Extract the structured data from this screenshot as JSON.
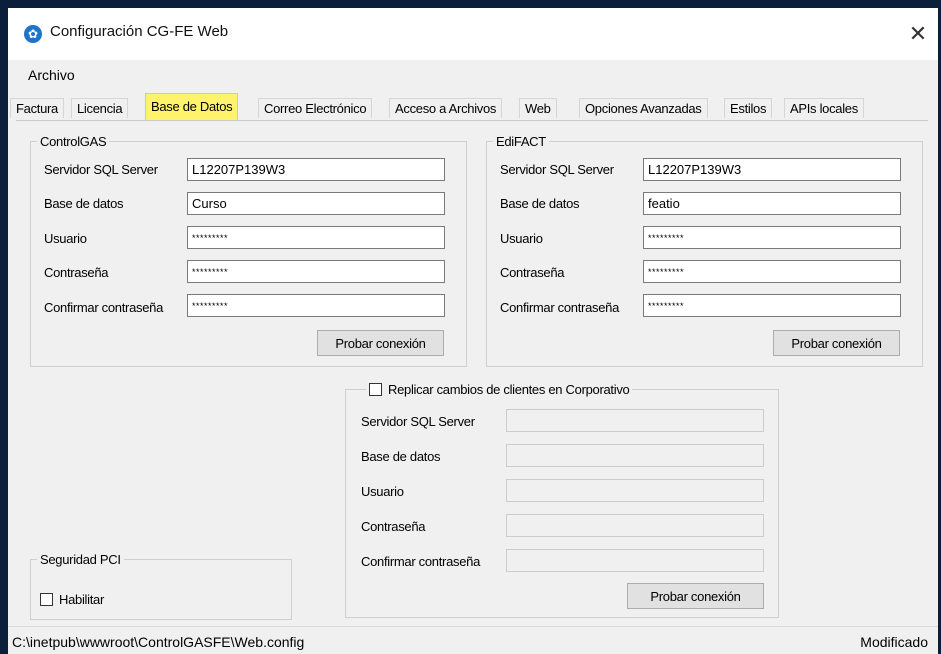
{
  "window": {
    "title": "Configuración CG-FE Web",
    "close_glyph": "✕"
  },
  "menu": {
    "archivo": "Archivo"
  },
  "tabs": [
    {
      "label": "Factura"
    },
    {
      "label": "Licencia"
    },
    {
      "label": "Base de Datos",
      "active": true
    },
    {
      "label": "Correo Electrónico"
    },
    {
      "label": "Acceso a Archivos"
    },
    {
      "label": "Web"
    },
    {
      "label": "Opciones Avanzadas"
    },
    {
      "label": "Estilos"
    },
    {
      "label": "APIs locales"
    }
  ],
  "controlgas": {
    "title": "ControlGAS",
    "server_label": "Servidor SQL Server",
    "server_value": "L12207P139W3",
    "db_label": "Base de datos",
    "db_value": "Curso",
    "user_label": "Usuario",
    "user_value": "*********",
    "pass_label": "Contraseña",
    "pass_value": "*********",
    "confirm_label": "Confirmar contraseña",
    "confirm_value": "*********",
    "test_button": "Probar conexión"
  },
  "edifact": {
    "title": "EdiFACT",
    "server_label": "Servidor SQL Server",
    "server_value": "L12207P139W3",
    "db_label": "Base de datos",
    "db_value": "featio",
    "user_label": "Usuario",
    "user_value": "*********",
    "pass_label": "Contraseña",
    "pass_value": "*********",
    "confirm_label": "Confirmar contraseña",
    "confirm_value": "*********",
    "test_button": "Probar conexión"
  },
  "replicar": {
    "checkbox_label": "Replicar cambios de clientes en Corporativo",
    "checked": false,
    "server_label": "Servidor SQL Server",
    "db_label": "Base de datos",
    "user_label": "Usuario",
    "pass_label": "Contraseña",
    "confirm_label": "Confirmar contraseña",
    "test_button": "Probar conexión"
  },
  "pci": {
    "title": "Seguridad PCI",
    "checkbox_label": "Habilitar",
    "checked": false
  },
  "status": {
    "path": "C:\\inetpub\\wwwroot\\ControlGASFE\\Web.config",
    "state": "Modificado"
  },
  "colors": {
    "active_tab": "#fff36b",
    "app_icon": "#1f73c9"
  }
}
